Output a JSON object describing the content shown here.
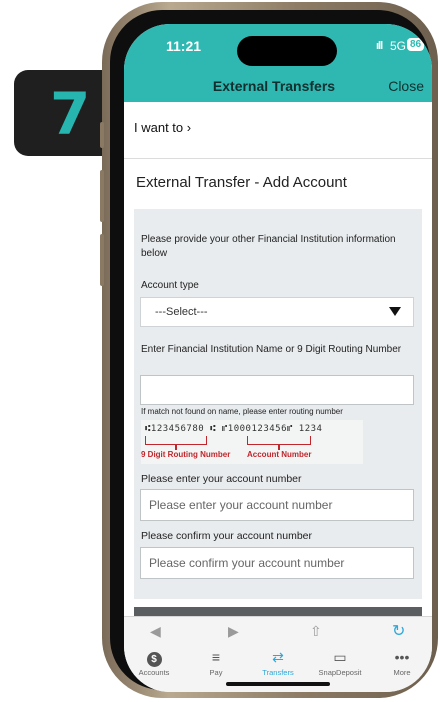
{
  "step": {
    "number": "7"
  },
  "status_bar": {
    "time": "11:21",
    "signal": "ıll",
    "network": "5G",
    "battery": "86"
  },
  "header": {
    "title": "External Transfers",
    "close_label": "Close"
  },
  "nav": {
    "i_want_to": "I want to ›"
  },
  "page": {
    "title": "External Transfer - Add Account"
  },
  "form": {
    "intro": "Please provide your other Financial Institution information below",
    "account_type_label": "Account type",
    "account_type_value": "---Select---",
    "institution_label": "Enter Financial Institution Name or 9 Digit Routing Number",
    "institution_value": "",
    "routing_hint": "If match not found on name, please enter routing number",
    "check_micr": "⑆123456780 ⑆  ⑈1000123456⑈  1234",
    "routing_caption": "9 Digit Routing Number",
    "account_caption": "Account Number",
    "account_number_label": "Please enter your account number",
    "account_number_placeholder": "Please enter your account number",
    "confirm_label": "Please confirm your account number",
    "confirm_placeholder": "Please confirm your account number"
  },
  "browser_toolbar": {
    "back_icon": "◀",
    "forward_icon": "▶",
    "share_icon": "⇧",
    "refresh_icon": "↻"
  },
  "tabs": [
    {
      "label": "Accounts",
      "icon": "$"
    },
    {
      "label": "Pay",
      "icon": "≡"
    },
    {
      "label": "Transfers",
      "icon": "⇄"
    },
    {
      "label": "SnapDeposit",
      "icon": "▭"
    },
    {
      "label": "More",
      "icon": "•••"
    }
  ],
  "colors": {
    "accent": "#2fb8b2",
    "link": "#2fa8d8",
    "badge_bg": "#1f1f1f",
    "caption_red": "#c0262b"
  }
}
